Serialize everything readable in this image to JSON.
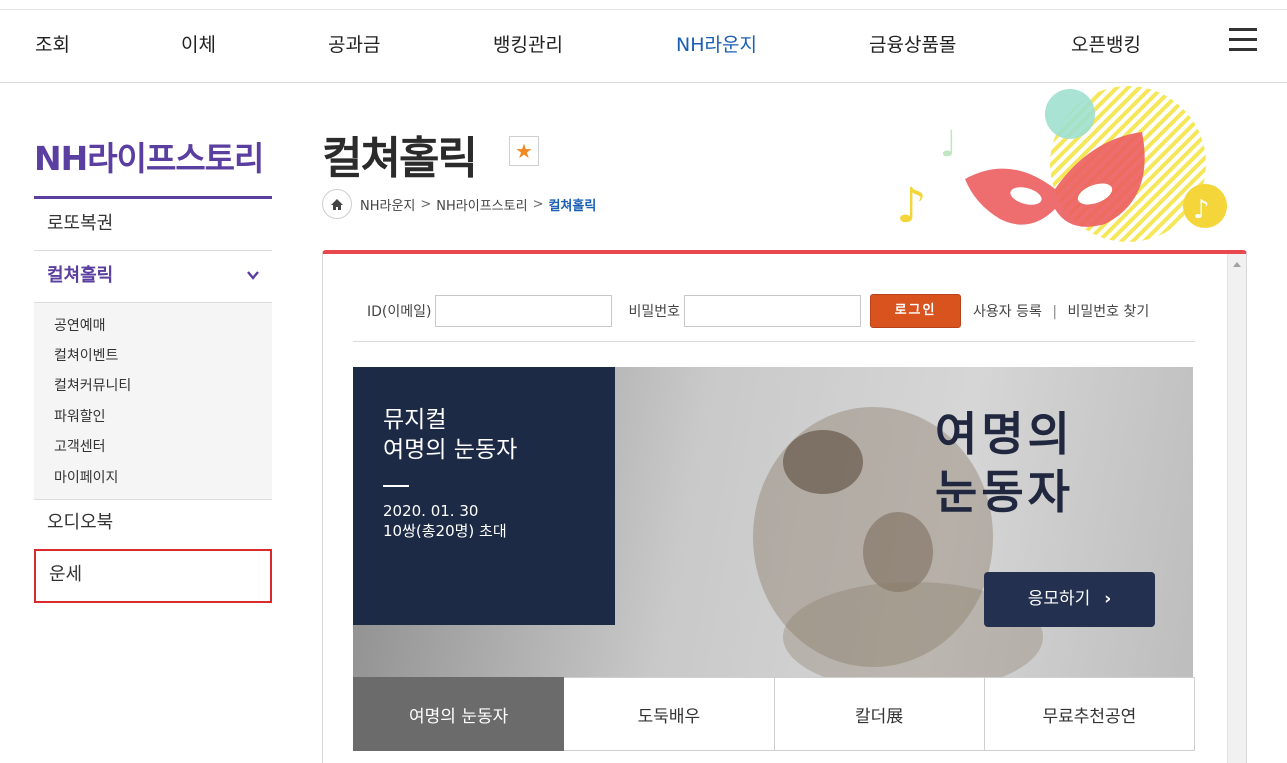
{
  "topnav": {
    "items": [
      "조회",
      "이체",
      "공과금",
      "뱅킹관리",
      "NH라운지",
      "금융상품몰",
      "오픈뱅킹"
    ],
    "active_index": 4
  },
  "sidebar": {
    "title": "NH라이프스토리",
    "items": [
      {
        "label": "로또복권"
      },
      {
        "label": "컬쳐홀릭"
      },
      {
        "label": "오디오북"
      },
      {
        "label": "운세"
      }
    ],
    "subitems": [
      "공연예매",
      "컬쳐이벤트",
      "컬쳐커뮤니티",
      "파워할인",
      "고객센터",
      "마이페이지"
    ]
  },
  "page": {
    "title": "컬쳐홀릭",
    "star_icon": "★"
  },
  "breadcrumb": {
    "items": [
      "NH라운지",
      "NH라이프스토리"
    ],
    "current": "컬쳐홀릭",
    "sep": ">"
  },
  "login": {
    "id_label": "ID(이메일)",
    "id_value": "",
    "pw_label": "비밀번호",
    "pw_value": "",
    "button": "로그인",
    "register": "사용자 등록",
    "find_pw": "비밀번호 찾기",
    "sep": "|"
  },
  "banner": {
    "category": "뮤지컬",
    "name": "여명의 눈동자",
    "date": "2020. 01. 30",
    "prize": "10쌍(총20명) 초대",
    "big_title_line1": "여명의",
    "big_title_line2": "눈동자",
    "apply": "응모하기"
  },
  "tabs": [
    "여명의 눈동자",
    "도둑배우",
    "칼더展",
    "무료추천공연"
  ],
  "colors": {
    "accent_purple": "#5b3fa0",
    "accent_blue": "#1a5fb4",
    "frame_red": "#e8484e",
    "login_orange": "#d9531e",
    "banner_navy": "#1d2a45"
  }
}
